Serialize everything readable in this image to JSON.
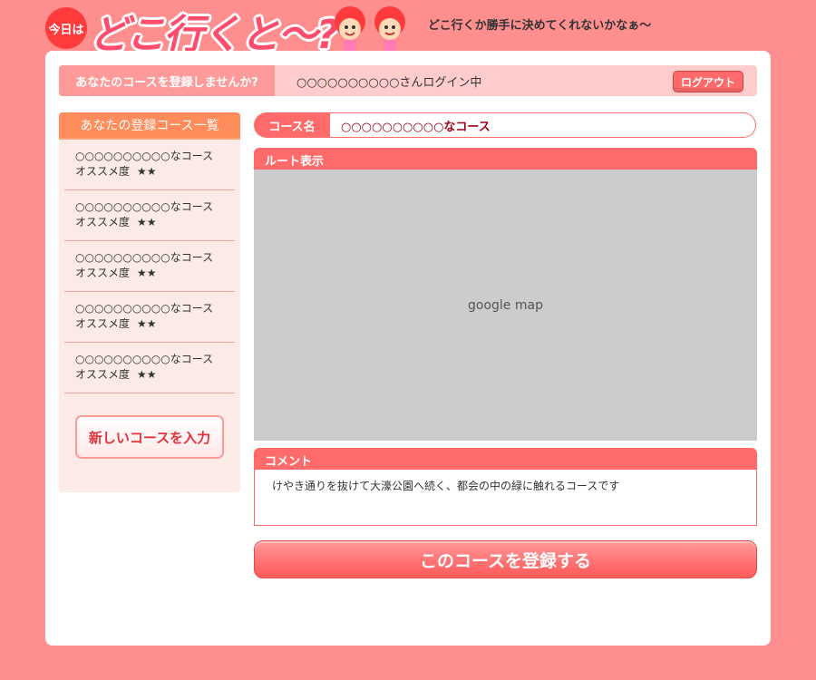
{
  "header": {
    "badge": "今日は",
    "logo": "どこ行くと〜?",
    "tagline": "どこ行くか勝手に決めてくれないかなぁ〜"
  },
  "topbar": {
    "prompt": "あなたのコースを登録しませんか?",
    "user_status": "○○○○○○○○○○さんログイン中",
    "logout_label": "ログアウト"
  },
  "sidebar": {
    "title": "あなたの登録コース一覧",
    "items": [
      {
        "name": "○○○○○○○○○○なコース",
        "rating_label": "オススメ度",
        "stars": "★★"
      },
      {
        "name": "○○○○○○○○○○なコース",
        "rating_label": "オススメ度",
        "stars": "★★"
      },
      {
        "name": "○○○○○○○○○○なコース",
        "rating_label": "オススメ度",
        "stars": "★★"
      },
      {
        "name": "○○○○○○○○○○なコース",
        "rating_label": "オススメ度",
        "stars": "★★"
      },
      {
        "name": "○○○○○○○○○○なコース",
        "rating_label": "オススメ度",
        "stars": "★★"
      }
    ],
    "new_course_label": "新しいコースを入力"
  },
  "main": {
    "course_name_label": "コース名",
    "course_name_value": "○○○○○○○○○○なコース",
    "route_title": "ルート表示",
    "map_placeholder": "google map",
    "comment_title": "コメント",
    "comment_text": "けやき通りを抜けて大濠公園へ続く、都会の中の緑に触れるコースです",
    "register_label": "このコースを登録する"
  },
  "colors": {
    "background": "#ff8f8f",
    "accent": "#ff6b6b",
    "sidebar_head": "#ff8c5a"
  }
}
